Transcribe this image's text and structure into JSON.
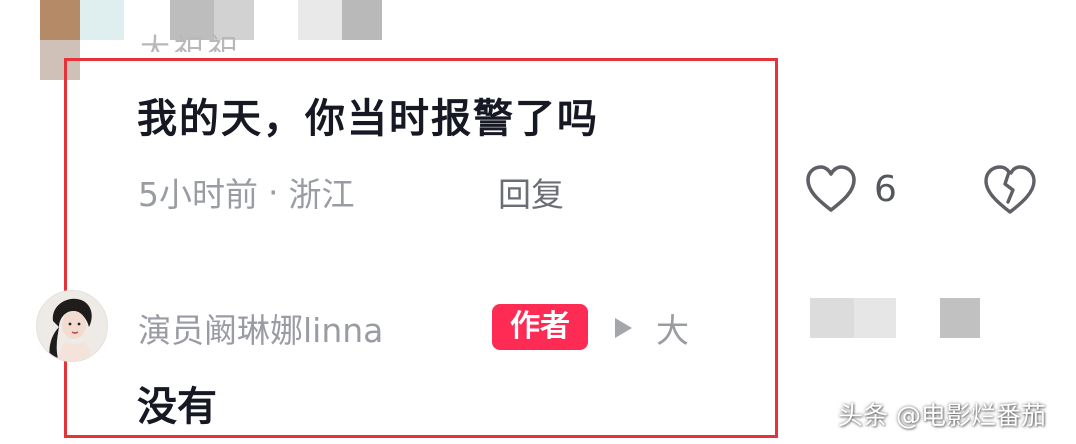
{
  "previous_comment": {
    "partial_text": "大祀祀"
  },
  "comment": {
    "text": "我的天，你当时报警了吗",
    "time": "5小时前",
    "separator": "·",
    "location": "浙江",
    "reply_label": "回复",
    "like_count": "6"
  },
  "reply": {
    "username": "演员阚琳娜linna",
    "badge": "作者",
    "reply_to": "大",
    "text": "没有"
  },
  "watermark": "头条 @电影烂番茄",
  "colors": {
    "highlight_border": "#e6333a",
    "badge_bg": "#fe2c55",
    "primary_text": "#161823",
    "secondary_text": "#9a9ca3"
  },
  "icons": {
    "like": "heart-outline-icon",
    "dislike": "broken-heart-icon",
    "arrow": "play-triangle-icon"
  }
}
